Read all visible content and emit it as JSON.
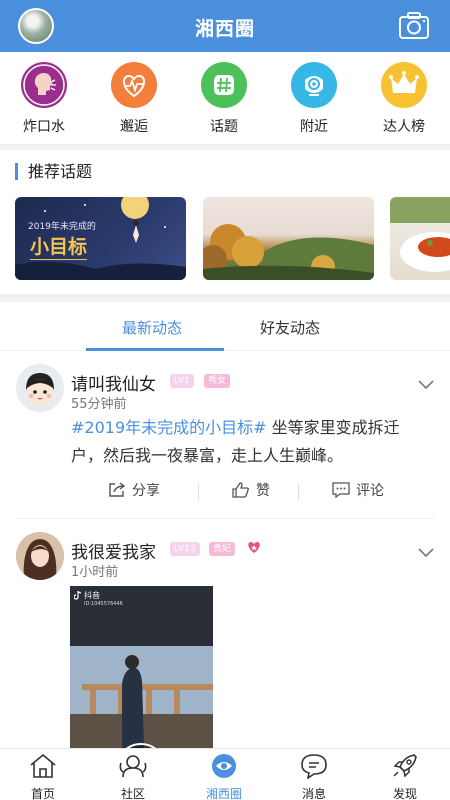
{
  "header": {
    "title": "湘西圈"
  },
  "categories": [
    {
      "label": "炸口水",
      "icon": "talking-head-icon",
      "color": "#9b2d8f"
    },
    {
      "label": "邂逅",
      "icon": "heartbeat-icon",
      "color": "#f47f3a"
    },
    {
      "label": "话题",
      "icon": "hashtag-icon",
      "color": "#4cc15a"
    },
    {
      "label": "附近",
      "icon": "location-eye-icon",
      "color": "#37b7e6"
    },
    {
      "label": "达人榜",
      "icon": "crown-icon",
      "color": "#f6c231"
    }
  ],
  "topics": {
    "heading": "推荐话题",
    "cards": [
      {
        "small": "2019年未完成的",
        "big": "小目标"
      },
      {
        "small": "",
        "big": ""
      },
      {
        "small": "",
        "big": ""
      }
    ]
  },
  "tabs": {
    "items": [
      "最新动态",
      "好友动态"
    ],
    "active": 0
  },
  "posts": [
    {
      "name": "请叫我仙女",
      "level": "LV1",
      "tag": "秀女",
      "time": "55分钟前",
      "hashtag": "#2019年未完成的小目标#",
      "text": " 坐等家里变成拆迁户，然后我一夜暴富，走上人生巅峰。",
      "actions": [
        "分享",
        "赞",
        "评论"
      ]
    },
    {
      "name": "我很爱我家",
      "level": "LV13",
      "tag": "贵妃",
      "time": "1小时前",
      "video": {
        "brand": "抖音",
        "id": "ID:1045576446"
      }
    }
  ],
  "bottom_nav": {
    "items": [
      "首页",
      "社区",
      "湘西圈",
      "消息",
      "发现"
    ],
    "active": 2
  },
  "colors": {
    "primary": "#4a90dd",
    "badge_level": "#f2c6e6",
    "badge_tag": "#f6b9d8"
  }
}
